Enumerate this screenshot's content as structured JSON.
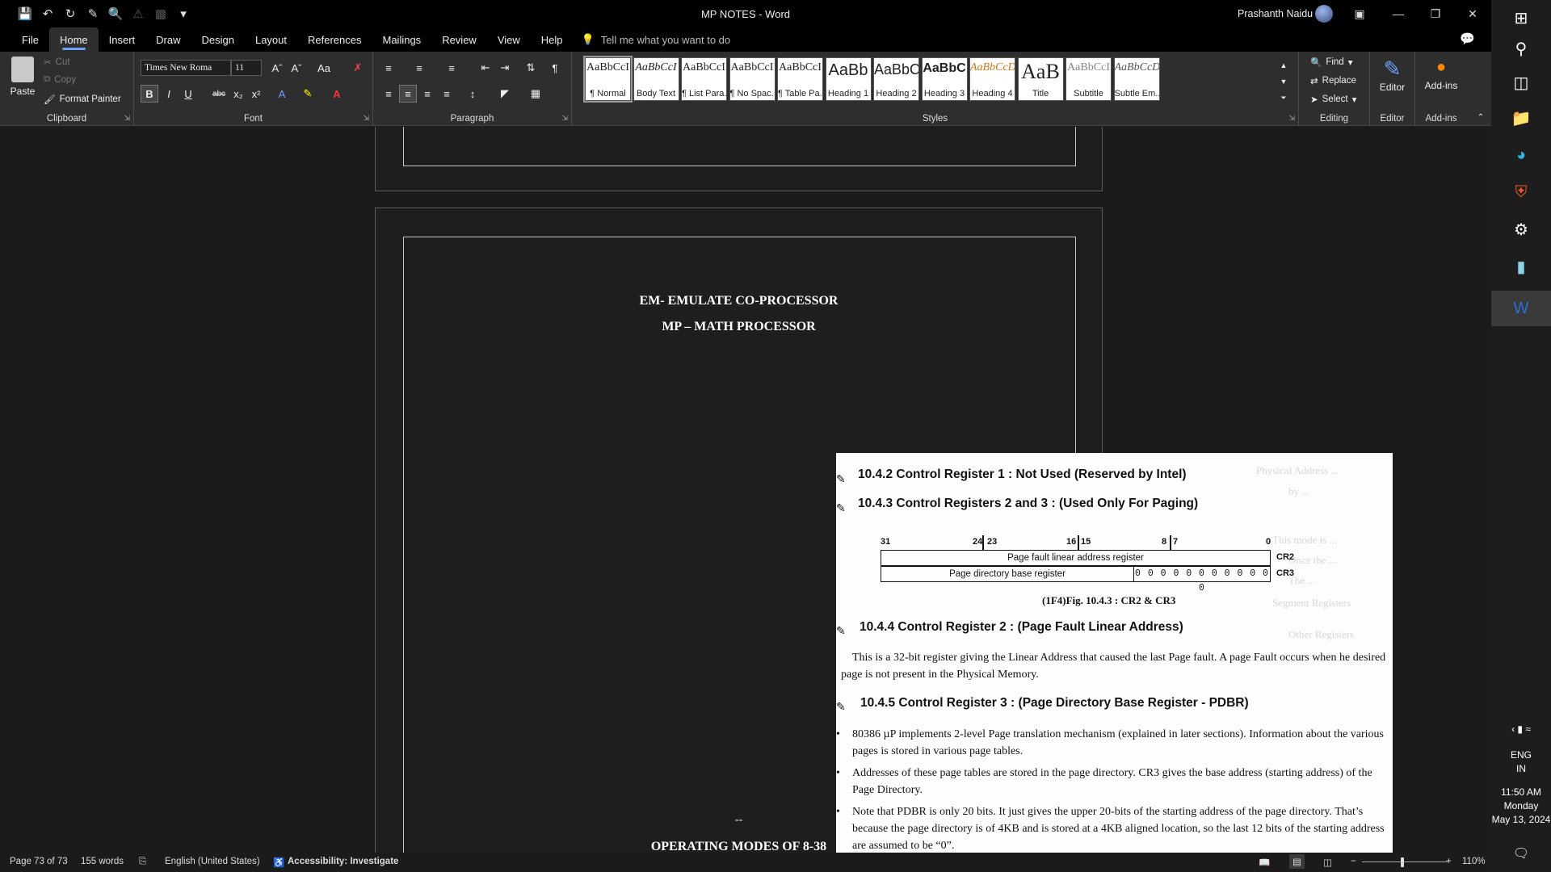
{
  "window": {
    "title": "MP NOTES  -  Word",
    "user": "Prashanth Naidu"
  },
  "tabs": [
    "File",
    "Home",
    "Insert",
    "Draw",
    "Design",
    "Layout",
    "References",
    "Mailings",
    "Review",
    "View",
    "Help"
  ],
  "tell_me": "Tell me what you want to do",
  "ribbon": {
    "clipboard": {
      "label": "Clipboard",
      "paste": "Paste",
      "cut": "Cut",
      "copy": "Copy",
      "format_painter": "Format Painter"
    },
    "font": {
      "label": "Font",
      "name": "Times New Roma",
      "size": "11",
      "case": "Aa"
    },
    "paragraph": {
      "label": "Paragraph"
    },
    "styles": {
      "label": "Styles",
      "items": [
        {
          "preview": "AaBbCcI",
          "name": "¶ Normal"
        },
        {
          "preview": "AaBbCcI",
          "name": "Body Text"
        },
        {
          "preview": "AaBbCcI",
          "name": "¶ List Para..."
        },
        {
          "preview": "AaBbCcI",
          "name": "¶ No Spac..."
        },
        {
          "preview": "AaBbCcI",
          "name": "¶ Table Pa..."
        },
        {
          "preview": "AaBb",
          "name": "Heading 1"
        },
        {
          "preview": "AaBbC",
          "name": "Heading 2"
        },
        {
          "preview": "AaBbC",
          "name": "Heading 3"
        },
        {
          "preview": "AaBbCcD",
          "name": "Heading 4"
        },
        {
          "preview": "AaB",
          "name": "Title"
        },
        {
          "preview": "AaBbCcI",
          "name": "Subtitle"
        },
        {
          "preview": "AaBbCcDi",
          "name": "Subtle Em..."
        }
      ]
    },
    "editing": {
      "label": "Editing",
      "find": "Find",
      "replace": "Replace",
      "select": "Select"
    },
    "editor": {
      "label": "Editor",
      "button": "Editor"
    },
    "addins": {
      "label": "Add-ins",
      "button": "Add-ins"
    }
  },
  "document": {
    "heading1": "EM- EMULATE CO-PROCESSOR",
    "heading2": "MP – MATH PROCESSOR",
    "separator": "--",
    "next_heading": "OPERATING MODES OF 8-38",
    "scan": {
      "h1": "10.4.2    Control Register 1 : Not Used (Reserved by Intel)",
      "h2": "10.4.3    Control Registers 2 and 3 : (Used Only For Paging)",
      "bits": [
        "31",
        "24",
        "23",
        "16",
        "15",
        "8",
        "7",
        "0"
      ],
      "cr2_text": "Page fault linear address register",
      "cr2": "CR2",
      "cr3_text": "Page directory base register",
      "cr3": "CR3",
      "zeros": "0 0 0 0 0 0 0 0 0 0 0 0",
      "fig": "(1F4)Fig. 10.4.3 : CR2 & CR3",
      "h3": "10.4.4    Control Register 2 : (Page Fault Linear Address)",
      "p1": "This is a 32-bit register giving the Linear Address that caused the last Page fault. A page Fault occurs when he desired page is not present in the Physical Memory.",
      "h4": "10.4.5    Control Register 3 : (Page Directory Base Register - PDBR)",
      "b1": "80386 µP implements 2-level Page translation mechanism (explained in later sections). Information about the various pages is stored in various page tables.",
      "b2": "Addresses of these page tables are stored in the page directory. CR3 gives the base address (starting address) of the Page Directory.",
      "b3": "Note that PDBR is only 20 bits. It just gives the upper 20-bits of the starting address of the page directory. That’s because the page directory is of 4KB and is stored at a 4KB aligned location, so the last 12 bits of the starting address are assumed to be “0”."
    }
  },
  "status": {
    "page": "Page 73 of 73",
    "words": "155 words",
    "language": "English (United States)",
    "accessibility": "Accessibility: Investigate",
    "zoom": "110%"
  },
  "taskbar": {
    "lang1": "ENG",
    "lang2": "IN",
    "time": "11:50 AM",
    "day": "Monday",
    "date": "May 13, 2024"
  }
}
